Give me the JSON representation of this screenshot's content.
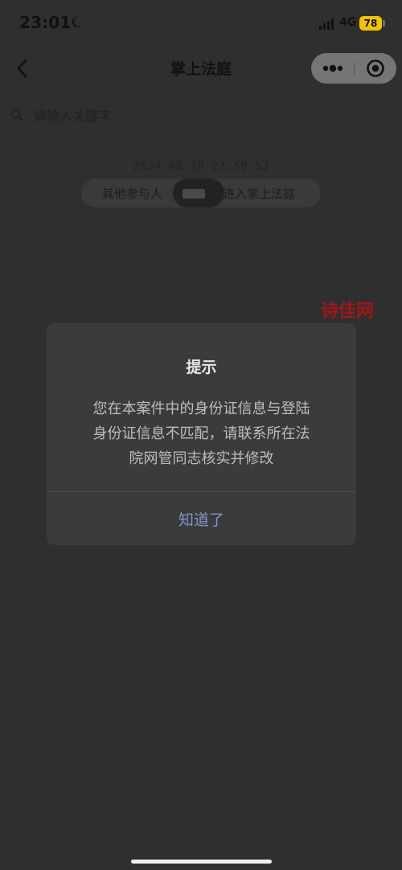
{
  "status_bar": {
    "time": "23:01",
    "network": "4G",
    "battery": "78"
  },
  "header": {
    "title": "掌上法庭"
  },
  "search": {
    "placeholder": "请输入关键字"
  },
  "message": {
    "timestamp": "2024-08-20 21:59:53",
    "left_text": "其他参与人",
    "right_text": "进入掌上法庭"
  },
  "watermark": "诗佳网",
  "modal": {
    "title": "提示",
    "lines": [
      "您在本案件中的身份证信息与登陆",
      "身份证信息不匹配，请联系所在法",
      "院网管同志核实并修改"
    ],
    "button_label": "知道了"
  },
  "colors": {
    "background": "#2f2f2f",
    "modal_background": "#3b3b3b",
    "battery": "#f0c400",
    "accent": "#7f98c6"
  },
  "icons": {
    "moon": "moon-icon",
    "signal": "signal-icon",
    "back": "chevron-left-icon",
    "more": "more-icon",
    "close": "target-icon",
    "search": "search-icon"
  }
}
